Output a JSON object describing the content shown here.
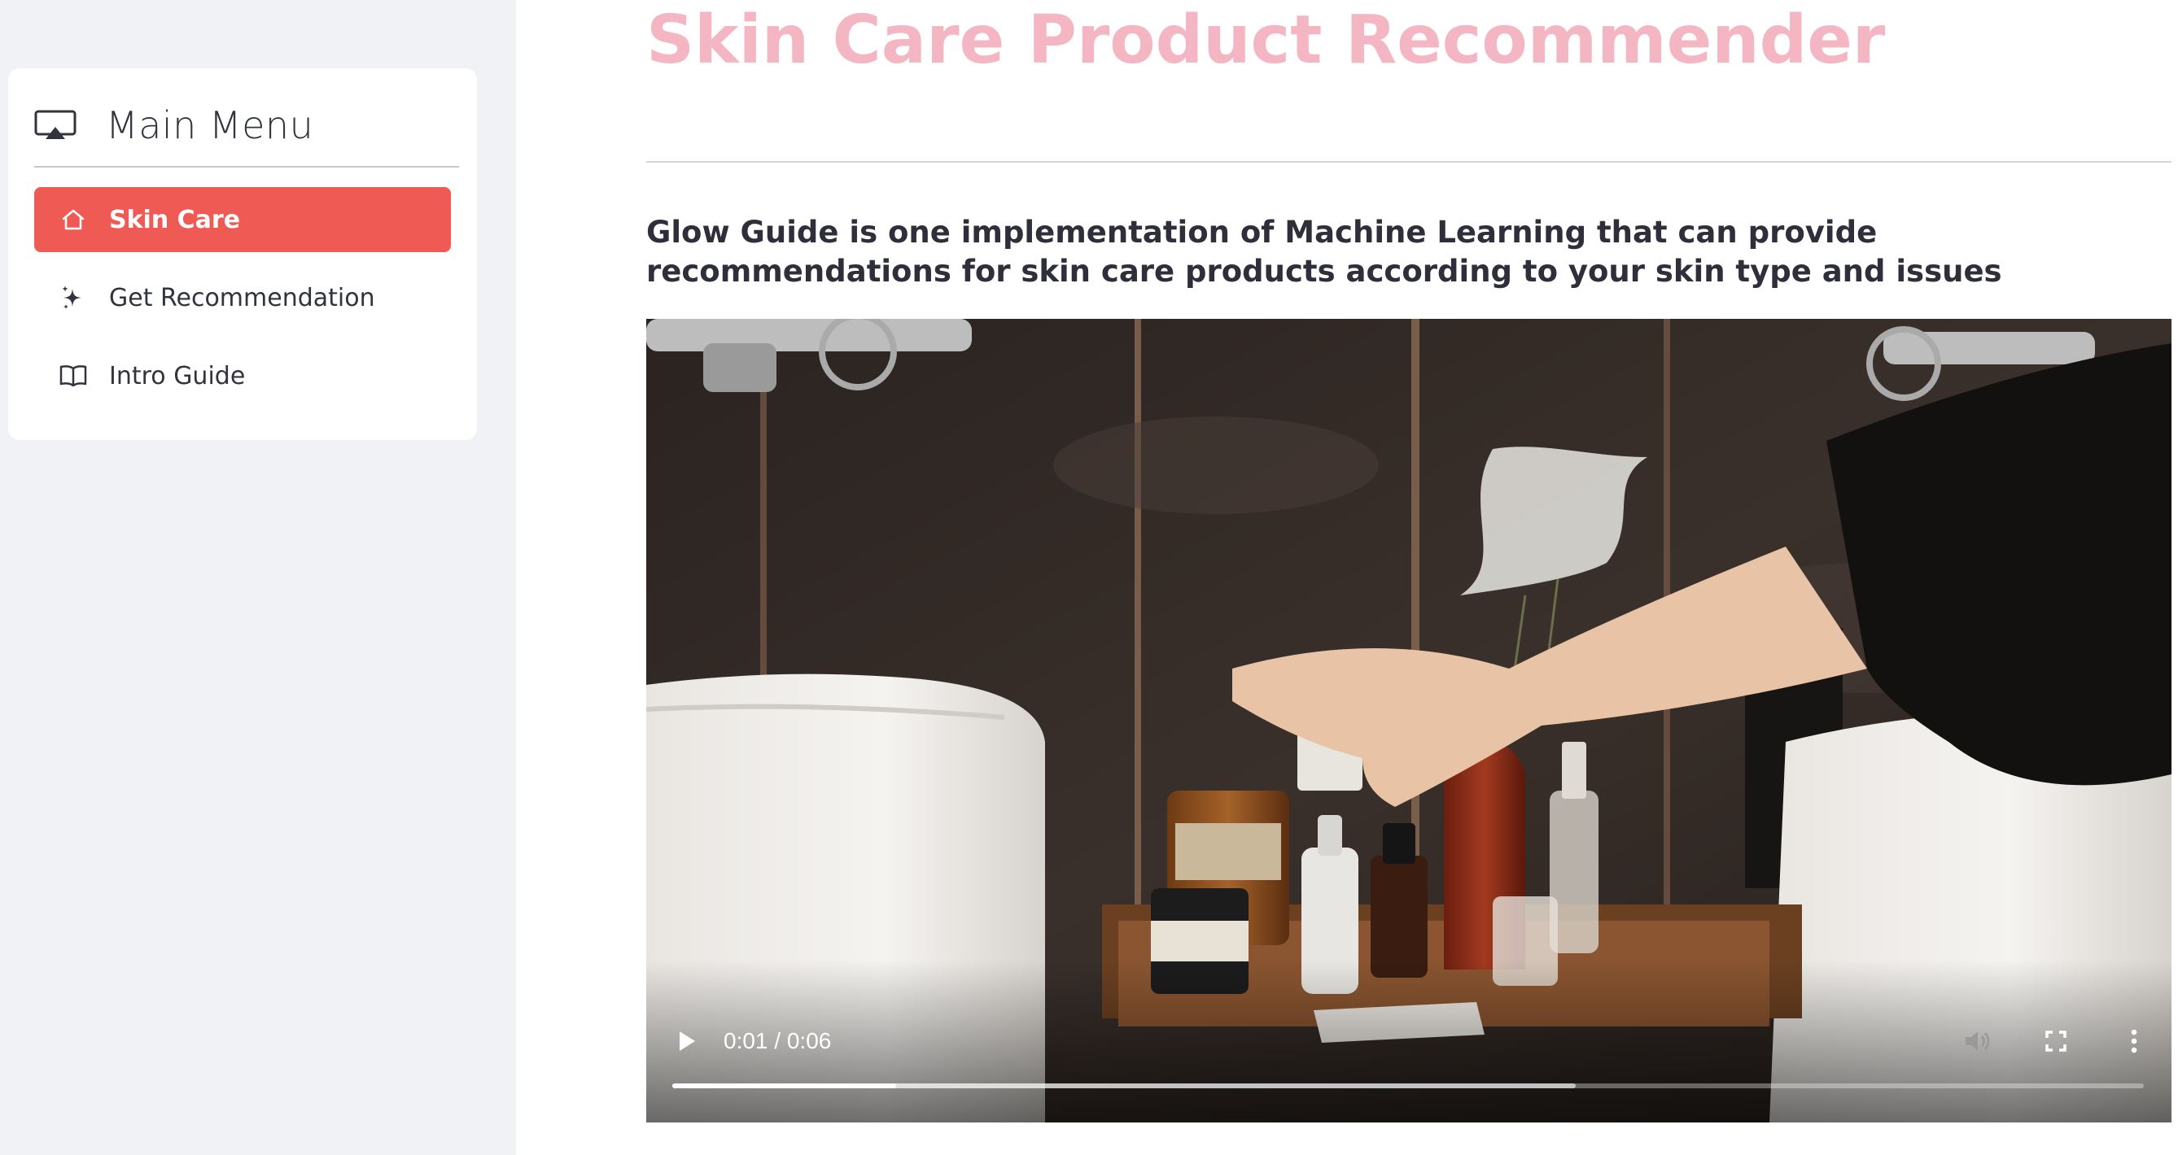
{
  "sidebar": {
    "title": "Main Menu",
    "items": [
      {
        "label": "Skin Care",
        "icon": "house-icon",
        "active": true
      },
      {
        "label": "Get Recommendation",
        "icon": "sparkles-icon",
        "active": false
      },
      {
        "label": "Intro Guide",
        "icon": "book-icon",
        "active": false
      }
    ]
  },
  "main": {
    "title": "Skin Care Product Recommender",
    "description": "Glow Guide is one implementation of Machine Learning that can provide recommendations for skin care products according to your skin type and issues"
  },
  "video": {
    "current_time": "0:01",
    "separator": " / ",
    "duration": "0:06",
    "played_fraction": 0.152,
    "buffered_fraction": 0.614
  },
  "colors": {
    "accent": "#ef5a55",
    "title": "#f4b6c2",
    "sidebar_bg": "#f0f2f6"
  }
}
